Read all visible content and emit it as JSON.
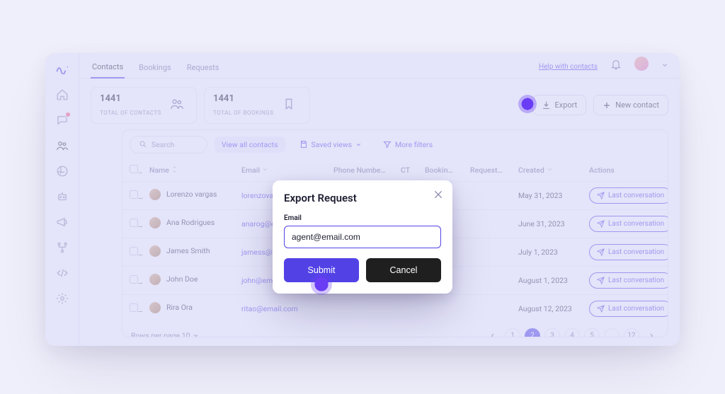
{
  "tabs": {
    "contacts": "Contacts",
    "bookings": "Bookings",
    "requests": "Requests"
  },
  "header": {
    "help": "Help with contacts"
  },
  "stats": {
    "contacts_value": "1441",
    "contacts_label": "TOTAL OF CONTACTS",
    "bookings_value": "1441",
    "bookings_label": "TOTAL OF BOOKINGS"
  },
  "actions": {
    "export": "Export",
    "new_contact": "New contact"
  },
  "toolbar": {
    "search_placeholder": "Search",
    "view_all": "View all contacts",
    "saved_views": "Saved views",
    "more_filters": "More filters"
  },
  "columns": {
    "name": "Name",
    "email": "Email",
    "phone": "Phone Number",
    "ct": "CT",
    "bookings": "Bookings",
    "requests": "Requests",
    "created": "Created",
    "actions": "Actions"
  },
  "rows": [
    {
      "name": "Lorenzo vargas",
      "email": "lorenzovargasg@email.com",
      "created": "May 31, 2023",
      "action": "Last conversation"
    },
    {
      "name": "Ana Rodrigues",
      "email": "anarog@email.com",
      "created": "June 31, 2023",
      "action": "Last conversation"
    },
    {
      "name": "James Smith",
      "email": "jamess@email.com",
      "created": "July 1, 2023",
      "action": "Last conversation"
    },
    {
      "name": "John Doe",
      "email": "john@email.com",
      "created": "August 1, 2023",
      "action": "Last conversation"
    },
    {
      "name": "Rira Ora",
      "email": "ritao@email.com",
      "created": "August 12, 2023",
      "action": "Last conversation"
    }
  ],
  "pagination": {
    "rows_per_page_label": "Rows per page",
    "rows_per_page_value": "10",
    "pages": [
      "1",
      "2",
      "3",
      "4",
      "5",
      "...",
      "12"
    ],
    "active_index": 1
  },
  "modal": {
    "title": "Export Request",
    "field_label": "Email",
    "field_value": "agent@email.com",
    "submit": "Submit",
    "cancel": "Cancel"
  }
}
